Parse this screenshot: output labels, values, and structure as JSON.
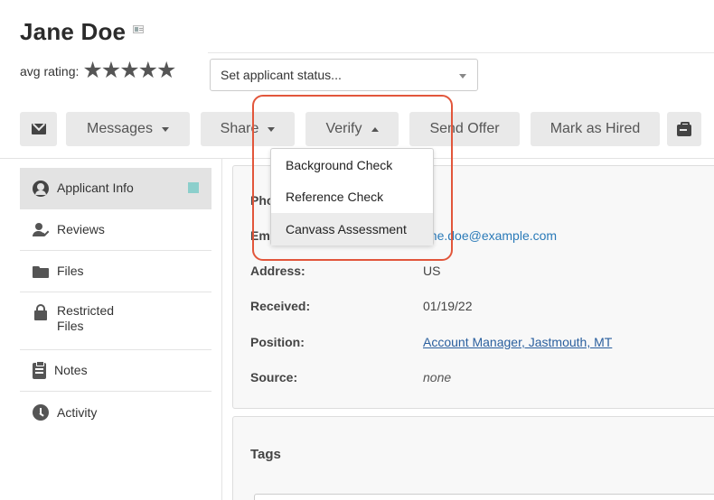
{
  "header": {
    "name": "Jane Doe",
    "rating_label": "avg rating:",
    "stars": "★★★★★",
    "status_select": {
      "value": "Set applicant status..."
    }
  },
  "toolbar": {
    "messages_label": "Messages",
    "share_label": "Share",
    "verify_label": "Verify",
    "send_offer_label": "Send Offer",
    "mark_hired_label": "Mark as Hired"
  },
  "verify_menu": {
    "items": [
      {
        "label": "Background Check"
      },
      {
        "label": "Reference Check"
      },
      {
        "label": "Canvass Assessment"
      }
    ]
  },
  "sidebar": {
    "items": [
      {
        "label": "Applicant Info",
        "icon": "person-circle-icon"
      },
      {
        "label": "Reviews",
        "icon": "reviews-icon"
      },
      {
        "label": "Files",
        "icon": "folder-icon"
      },
      {
        "label": "Restricted",
        "label2": "Files",
        "icon": "lock-icon"
      },
      {
        "label": "Notes",
        "icon": "clipboard-icon"
      },
      {
        "label": "Activity",
        "icon": "clock-icon"
      }
    ]
  },
  "info": {
    "phone_label": "Pho",
    "email_label": "Em",
    "email_value": "ane.doe@example.com",
    "address_label": "Address:",
    "address_value": "US",
    "received_label": "Received:",
    "received_value": "01/19/22",
    "position_label": "Position:",
    "position_value": "Account Manager, Jastmouth, MT",
    "source_label": "Source:",
    "source_value": "none"
  },
  "tags": {
    "title": "Tags"
  },
  "colors": {
    "highlight": "#e2563b",
    "accent_teal": "#8ccfcc",
    "link": "#2a7ab8"
  }
}
